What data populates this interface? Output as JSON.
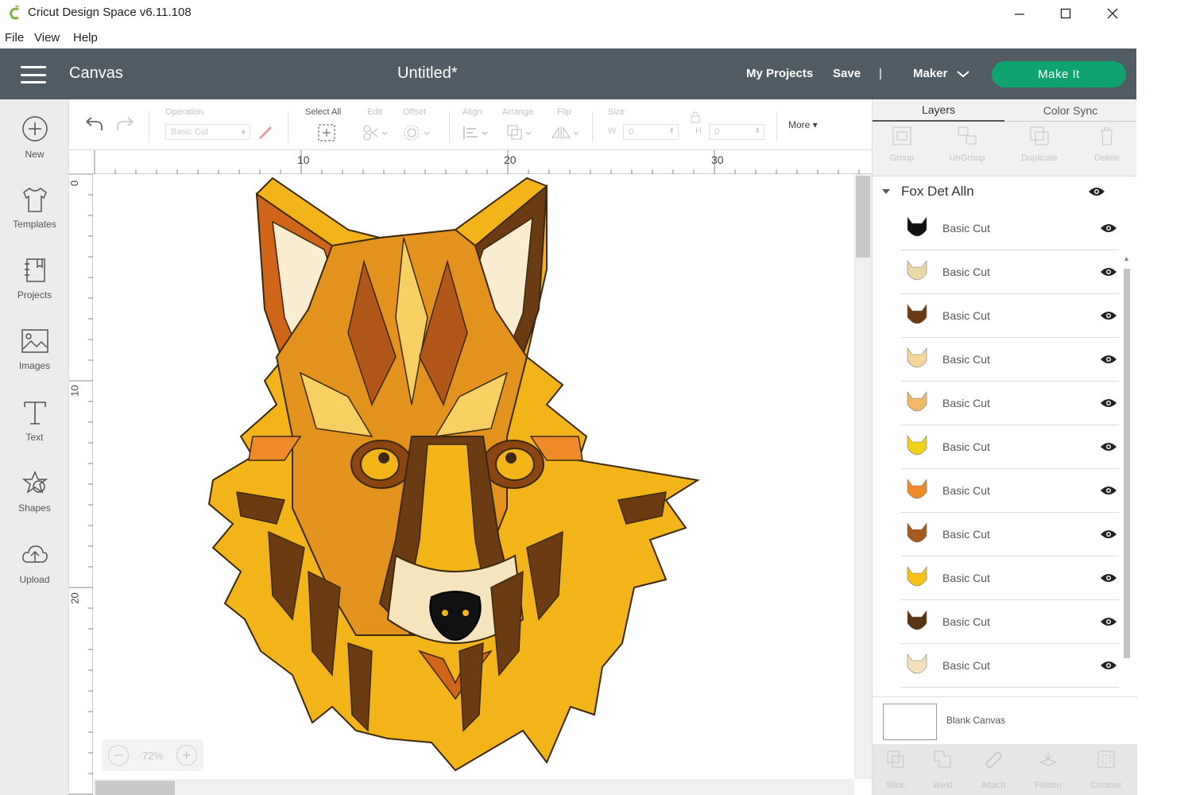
{
  "app": {
    "title": "Cricut Design Space  v6.11.108",
    "logo_icon": "cricut-logo-icon",
    "accent_color": "#10a26f",
    "header_color": "#525c64"
  },
  "menu": [
    "File",
    "View",
    "Help"
  ],
  "header": {
    "section": "Canvas",
    "document_title": "Untitled*",
    "my_projects": "My Projects",
    "save": "Save",
    "separator": "|",
    "machine": "Maker",
    "make_it": "Make It"
  },
  "leftnav": [
    {
      "label": "New",
      "icon": "plus-circle-icon"
    },
    {
      "label": "Templates",
      "icon": "tshirt-icon"
    },
    {
      "label": "Projects",
      "icon": "projects-icon"
    },
    {
      "label": "Images",
      "icon": "image-icon"
    },
    {
      "label": "Text",
      "icon": "text-icon"
    },
    {
      "label": "Shapes",
      "icon": "shapes-icon"
    },
    {
      "label": "Upload",
      "icon": "upload-icon"
    }
  ],
  "toolbar": {
    "operation_label": "Operation",
    "operation_value": "Basic Cut",
    "select_all": "Select All",
    "edit": "Edit",
    "offset": "Offset",
    "align": "Align",
    "arrange": "Arrange",
    "flip": "Flip",
    "size": "Size",
    "w_label": "W",
    "w_value": "0",
    "h_label": "H",
    "h_value": "0",
    "more": "More"
  },
  "rulers": {
    "horizontal": [
      "10",
      "20",
      "30"
    ],
    "vertical": [
      "0",
      "10",
      "20"
    ]
  },
  "zoom": {
    "value": "72%",
    "minus": "−",
    "plus": "+"
  },
  "panel": {
    "tabs": [
      "Layers",
      "Color Sync"
    ],
    "actions": [
      "Group",
      "UnGroup",
      "Duplicate",
      "Delete"
    ],
    "group_name": "Fox Det Alln",
    "layers": [
      {
        "name": "Basic Cut",
        "color": "#111111"
      },
      {
        "name": "Basic Cut",
        "color": "#ead9a8"
      },
      {
        "name": "Basic Cut",
        "color": "#6b3b14"
      },
      {
        "name": "Basic Cut",
        "color": "#f6d79a"
      },
      {
        "name": "Basic Cut",
        "color": "#f3b968"
      },
      {
        "name": "Basic Cut",
        "color": "#f0d21a"
      },
      {
        "name": "Basic Cut",
        "color": "#ee8a2a"
      },
      {
        "name": "Basic Cut",
        "color": "#a85a1e"
      },
      {
        "name": "Basic Cut",
        "color": "#f6c21a"
      },
      {
        "name": "Basic Cut",
        "color": "#5a3410"
      },
      {
        "name": "Basic Cut",
        "color": "#f4e2bd"
      }
    ],
    "blank_canvas": "Blank Canvas",
    "bottom_tools": [
      "Slice",
      "Weld",
      "Attach",
      "Flatten",
      "Contour"
    ]
  }
}
